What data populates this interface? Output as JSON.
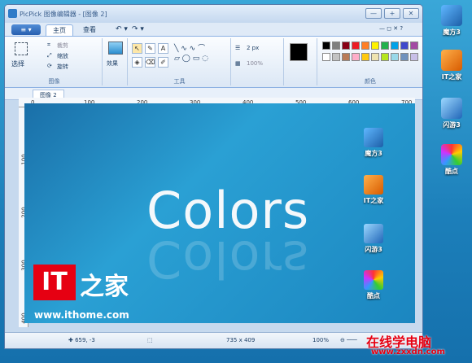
{
  "window": {
    "title": "PicPick 图像编辑器 - [图像 2]",
    "buttons": [
      "—",
      "+",
      "✕"
    ]
  },
  "ribbon_tabs": {
    "menu": "≡ ▾",
    "home": "主页",
    "view": "查看"
  },
  "ribbon": {
    "image_group": "图像",
    "select": "选择",
    "crop": "裁剪",
    "resize": "缩放",
    "rotate": "旋转",
    "effects": "效果",
    "tools_group": "工具",
    "colors_group": "颜色",
    "stroke_size": "2 px",
    "opacity": "100%"
  },
  "palette": [
    "#000000",
    "#7f7f7f",
    "#880015",
    "#ed1c24",
    "#ff7f27",
    "#fff200",
    "#22b14c",
    "#00a2e8",
    "#3f48cc",
    "#a349a4",
    "#ffffff",
    "#c3c3c3",
    "#b97a57",
    "#ffaec9",
    "#ffc90e",
    "#efe4b0",
    "#b5e61d",
    "#99d9ea",
    "#7092be",
    "#c8bfe7"
  ],
  "doc": {
    "tab": "图像 2"
  },
  "ruler": {
    "h": [
      "0",
      "100",
      "200",
      "300",
      "400",
      "500",
      "600",
      "700"
    ],
    "v": [
      "100",
      "200",
      "300",
      "400"
    ]
  },
  "canvas": {
    "headline": "Colors",
    "icons": [
      "魔方3",
      "IT之家",
      "闪游3",
      "酷点"
    ]
  },
  "desktop_icons": [
    "魔方3",
    "IT之家",
    "闪游3",
    "酷点"
  ],
  "status": {
    "pos": "✚ 659, -3",
    "size": "735 x 409",
    "zoom": "100%"
  },
  "overlay": {
    "logo": "IT",
    "logo_text": "之家",
    "url": "www.ithome.com",
    "watermark": "在线学电脑",
    "watermark_url": "www.zxxdn.com"
  }
}
